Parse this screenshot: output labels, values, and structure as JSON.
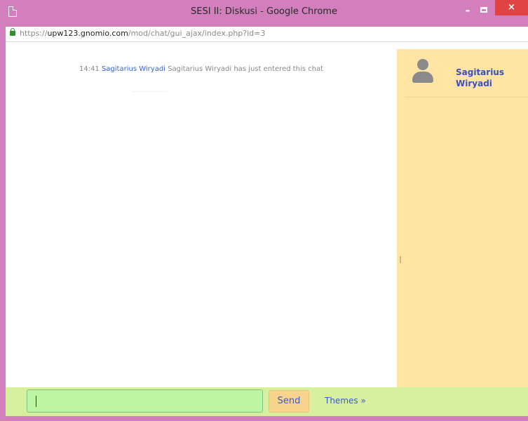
{
  "window": {
    "title": "SESI II: Diskusi - Google Chrome",
    "minimize_label": "-",
    "close_label": "×"
  },
  "address": {
    "scheme": "https://",
    "host": "upw123.gnomio.com",
    "path": "/mod/chat/gui_ajax/index.php?id=3"
  },
  "chat": {
    "messages": [
      {
        "time": "14:41",
        "user": "Sagitarius Wiryadi",
        "text": "Sagitarius Wiryadi has just entered this chat"
      }
    ]
  },
  "users_panel": {
    "users": [
      {
        "name": "Sagitarius Wiryadi",
        "avatar": "user-silhouette-icon"
      }
    ]
  },
  "footer": {
    "input_value": "",
    "send_label": "Send",
    "themes_label": "Themes »"
  },
  "colors": {
    "window_frame": "#d37fbd",
    "users_panel_bg": "#ffe4a4",
    "footer_bg": "#d7f09f",
    "input_bg": "#bdf5a3",
    "send_bg": "#f7d48b",
    "link": "#3a5bbf",
    "close_button": "#e04343"
  }
}
